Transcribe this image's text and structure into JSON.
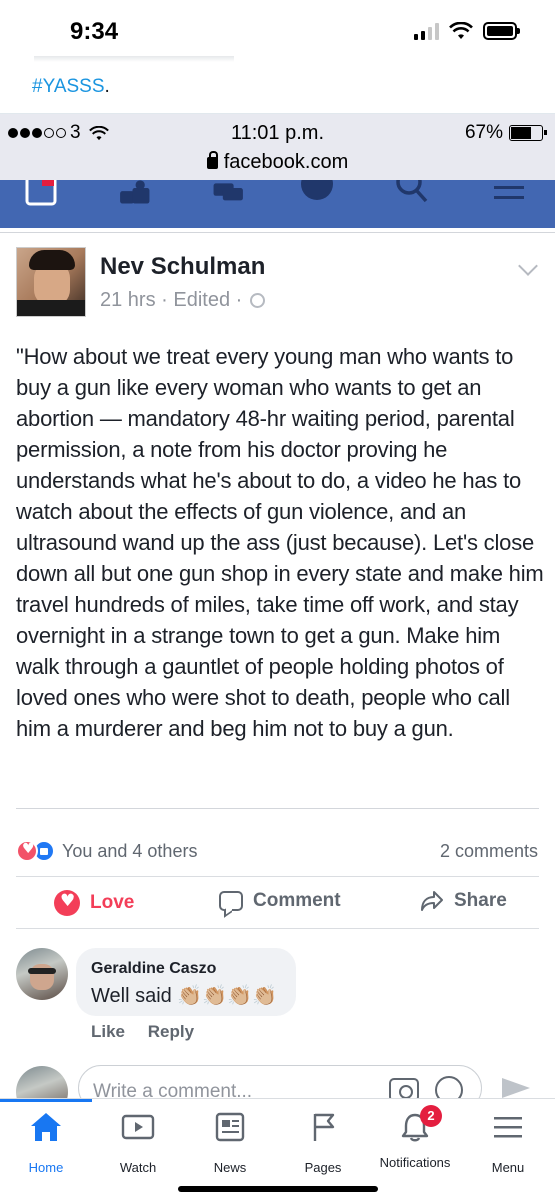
{
  "outer_status": {
    "time": "9:34"
  },
  "tweet": {
    "hashtag": "#YASSS",
    "hashtag_suffix": "."
  },
  "inner_status": {
    "carrier": "3",
    "time": "11:01 p.m.",
    "battery": "67%",
    "url": "facebook.com"
  },
  "post": {
    "author": "Nev Schulman",
    "meta": "21 hrs · Edited ·",
    "text": "\"How about we treat every young man who wants to buy a gun like every woman who wants to get an abortion — mandatory 48-hr waiting period, parental permission, a note from his doctor proving he understands what he's about to do, a video he has to watch about the effects of gun violence, and an ultrasound wand up the ass (just because). Let's close down all but one gun shop in every state and make him travel hundreds of miles, take time off work, and stay overnight in a strange town to get a gun. Make him walk through a gauntlet of people holding photos of loved ones who were shot to death, people who call him a murderer and beg him not to buy a gun."
  },
  "reactions": {
    "summary": "You and 4 others",
    "comments_count": "2 comments"
  },
  "actions": {
    "love": "Love",
    "comment": "Comment",
    "share": "Share"
  },
  "comment": {
    "author": "Geraldine Caszo",
    "text": "Well said",
    "emoji": "👏🏼👏🏼👏🏼👏🏼",
    "like": "Like",
    "reply": "Reply"
  },
  "composer": {
    "placeholder": "Write a comment..."
  },
  "tabbar": {
    "tabs": [
      {
        "label": "Home",
        "icon": "home-icon"
      },
      {
        "label": "Watch",
        "icon": "watch-icon"
      },
      {
        "label": "News",
        "icon": "news-icon"
      },
      {
        "label": "Pages",
        "icon": "pages-flag-icon"
      },
      {
        "label": "Notifications",
        "icon": "bell-icon",
        "badge": "2"
      },
      {
        "label": "Menu",
        "icon": "hamburger-icon"
      }
    ]
  },
  "colors": {
    "fb_blue": "#4267b2",
    "active_blue": "#1877f2",
    "love_red": "#f33e58",
    "badge_red": "#e41e3f"
  }
}
